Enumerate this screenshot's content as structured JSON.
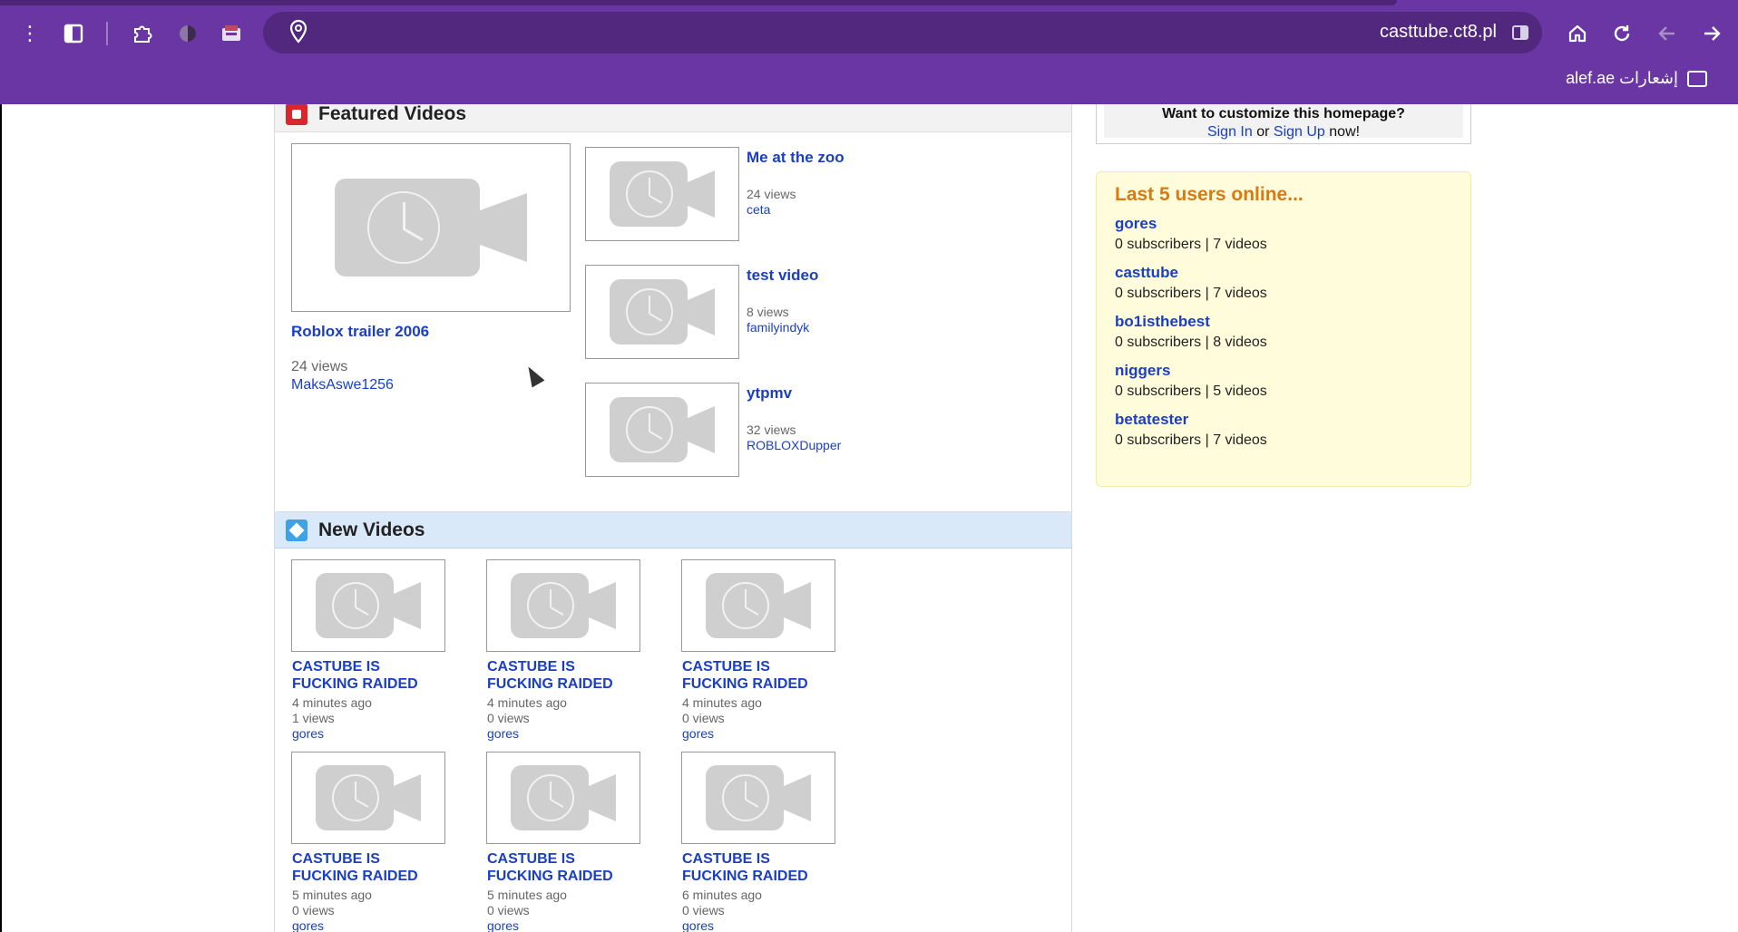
{
  "browser": {
    "url": "casttube.ct8.pl",
    "bookmark_label": "alef.ae إشعارات"
  },
  "featured": {
    "heading": "Featured Videos",
    "main": {
      "title": "Roblox trailer 2006",
      "views": "24 views",
      "user": "MaksAswe1256"
    },
    "side": [
      {
        "title": "Me at the zoo",
        "views": "24 views",
        "user": "ceta"
      },
      {
        "title": "test video",
        "views": "8 views",
        "user": "familyindyk"
      },
      {
        "title": "ytpmv",
        "views": "32 views",
        "user": "ROBLOXDupper"
      }
    ]
  },
  "new_videos": {
    "heading": "New Videos",
    "items": [
      {
        "title_line1": "CASTUBE IS",
        "title_line2": "FUCKING RAIDED",
        "time": "4 minutes ago",
        "views": "1 views",
        "user": "gores"
      },
      {
        "title_line1": "CASTUBE IS",
        "title_line2": "FUCKING RAIDED",
        "time": "4 minutes ago",
        "views": "0 views",
        "user": "gores"
      },
      {
        "title_line1": "CASTUBE IS",
        "title_line2": "FUCKING RAIDED",
        "time": "4 minutes ago",
        "views": "0 views",
        "user": "gores"
      },
      {
        "title_line1": "CASTUBE IS",
        "title_line2": "FUCKING RAIDED",
        "time": "5 minutes ago",
        "views": "0 views",
        "user": "gores"
      },
      {
        "title_line1": "CASTUBE IS",
        "title_line2": "FUCKING RAIDED",
        "time": "5 minutes ago",
        "views": "0 views",
        "user": "gores"
      },
      {
        "title_line1": "CASTUBE IS",
        "title_line2": "FUCKING RAIDED",
        "time": "6 minutes ago",
        "views": "0 views",
        "user": "gores"
      }
    ]
  },
  "customize": {
    "title": "Want to customize this homepage?",
    "sign_in": "Sign In",
    "or": "or",
    "sign_up": "Sign Up",
    "now": "now!"
  },
  "online": {
    "title": "Last 5 users online...",
    "users": [
      {
        "name": "gores",
        "stats": "0 subscribers | 7 videos"
      },
      {
        "name": "casttube",
        "stats": "0 subscribers | 7 videos"
      },
      {
        "name": "bo1isthebest",
        "stats": "0 subscribers | 8 videos"
      },
      {
        "name": "niggers",
        "stats": "0 subscribers | 5 videos"
      },
      {
        "name": "betatester",
        "stats": "0 subscribers | 7 videos"
      }
    ]
  },
  "colors": {
    "chrome": "#6a36a4",
    "omnibox": "#52287f",
    "link": "#1a3fc2",
    "online_title": "#d77a12"
  }
}
